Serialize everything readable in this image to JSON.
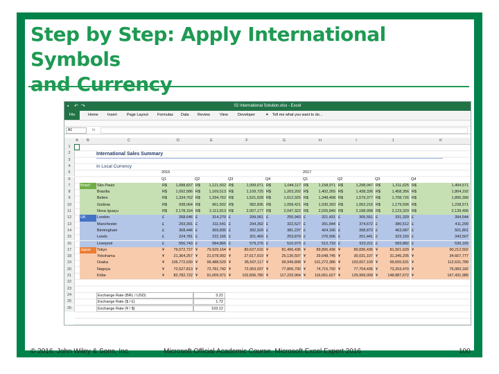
{
  "slide": {
    "title_line1": "Step by Step: Apply International Symbols",
    "title_line2": "and Currency",
    "footer_left": "© 2016, John Wiley & Sons, Inc.",
    "footer_center": "Microsoft Official Academic Course, Microsoft Excel Expert 2016",
    "footer_page": "100"
  },
  "excel": {
    "filename": "02 International Solution.xlsx - Excel",
    "tabs": [
      "File",
      "Home",
      "Insert",
      "Page Layout",
      "Formulas",
      "Data",
      "Review",
      "View",
      "Developer"
    ],
    "tell_me": "Tell me what you want to do...",
    "namebox": "A1",
    "fx": "fx",
    "columns": [
      "A",
      "B",
      "C",
      "D",
      "E",
      "F",
      "G",
      "H",
      "I",
      "J",
      "K"
    ],
    "rows": [
      "1",
      "2",
      "3",
      "4",
      "5",
      "6",
      "7",
      "8",
      "9",
      "10",
      "11",
      "12",
      "13",
      "14",
      "15",
      "16",
      "17",
      "18",
      "19",
      "20",
      "21",
      "22",
      "23",
      "24",
      "25",
      "26"
    ],
    "heading": "International Sales Summary",
    "subheading": "In Local Currency",
    "year1": "2016",
    "year2": "2017",
    "quarters": [
      "Q1",
      "Q2",
      "Q3",
      "Q4",
      "Q1",
      "Q2",
      "Q3",
      "Q4"
    ],
    "regions": [
      {
        "name": "Brazil",
        "color": "green",
        "symbol": "R$",
        "cities": [
          {
            "city": "São Paulo",
            "v": [
              "1,088,837",
              "1,121,502",
              "1,099,071",
              "1,044,117",
              "1,158,971",
              "1,298,047",
              "1,311,625",
              "1,494,571"
            ]
          },
          {
            "city": "Brasília",
            "v": [
              "1,092,586",
              "1,169,513",
              "1,109,725",
              "1,263,202",
              "1,402,265",
              "1,438,336",
              "1,458,356",
              "1,804,192"
            ]
          },
          {
            "city": "Belém",
            "v": [
              "1,334,762",
              "1,334,762",
              "1,521,628",
              "1,612,925",
              "1,348,408",
              "1,579,377",
              "1,708,726",
              "1,896,396"
            ]
          },
          {
            "city": "Goiânia",
            "v": [
              "938,064",
              "961,502",
              "982,836",
              "1,058,421",
              "1,030,393",
              "1,062,216",
              "1,179,596",
              "1,238,571"
            ]
          },
          {
            "city": "Nova Iguaçu",
            "v": [
              "2,178,164",
              "2,112,813",
              "2,007,177",
              "2,047,322",
              "2,026,849",
              "2,188,998",
              "2,123,329",
              "2,139,495"
            ]
          }
        ]
      },
      {
        "name": "UK",
        "color": "blue",
        "symbol": "£",
        "cities": [
          {
            "city": "London",
            "v": [
              "268,646",
              "314,270",
              "299,061",
              "255,943",
              "321,431",
              "305,551",
              "331,329",
              "394,544"
            ]
          },
          {
            "city": "Manchester",
            "v": [
              "293,391",
              "311,541",
              "294,392",
              "322,527",
              "391,844",
              "374,672",
              "380,512",
              "411,299"
            ]
          },
          {
            "city": "Birmingham",
            "v": [
              "368,446",
              "369,835",
              "392,929",
              "381,237",
              "424,166",
              "398,873",
              "463,687",
              "501,801"
            ]
          },
          {
            "city": "Leeds",
            "v": [
              "224,781",
              "222,165",
              "201,469",
              "253,879",
              "276,596",
              "201,441",
              "323,150",
              "343,507"
            ]
          },
          {
            "city": "Liverpool",
            "v": [
              "556,743",
              "584,866",
              "579,276",
              "510,973",
              "512,733",
              "523,211",
              "583,882",
              "530,165"
            ]
          }
        ]
      },
      {
        "name": "Japan",
        "color": "orange",
        "symbol": "¥",
        "cities": [
          {
            "city": "Tokyo",
            "v": [
              "79,072,727",
              "79,929,164",
              "80,627,616",
              "81,496,436",
              "89,896,436",
              "89,836,436",
              "81,901,629",
              "90,212,502"
            ]
          },
          {
            "city": "Yokohama",
            "v": [
              "21,364,257",
              "21,578,992",
              "27,617,919",
              "25,130,507",
              "29,648,745",
              "30,031,107",
              "31,345,205",
              "34,667,777"
            ]
          },
          {
            "city": "Osaka",
            "v": [
              "106,772,630",
              "99,488,529",
              "95,507,117",
              "99,949,808",
              "101,272,386",
              "103,007,109",
              "99,655,531",
              "112,631,789"
            ]
          },
          {
            "city": "Nagoya",
            "v": [
              "72,527,813",
              "72,781,742",
              "72,063,037",
              "77,806,700",
              "74,715,792",
              "77,704,436",
              "73,253,470",
              "76,083,182"
            ]
          },
          {
            "city": "Kōbe",
            "v": [
              "82,782,722",
              "91,009,971",
              "102,836,780",
              "117,233,964",
              "116,061,627",
              "129,999,009",
              "148,887,672",
              "167,431,985"
            ]
          }
        ]
      }
    ],
    "exchange": [
      {
        "label": "Exchange Rate (BRL / USD)",
        "value": "3.22"
      },
      {
        "label": "Exchange Rate ($ / £)",
        "value": "1.72"
      },
      {
        "label": "Exchange Rate (¥ / $)",
        "value": "103.12"
      }
    ]
  },
  "colors": {
    "frame": "#00824a",
    "title": "#1e9a53",
    "excel_green": "#217346"
  }
}
